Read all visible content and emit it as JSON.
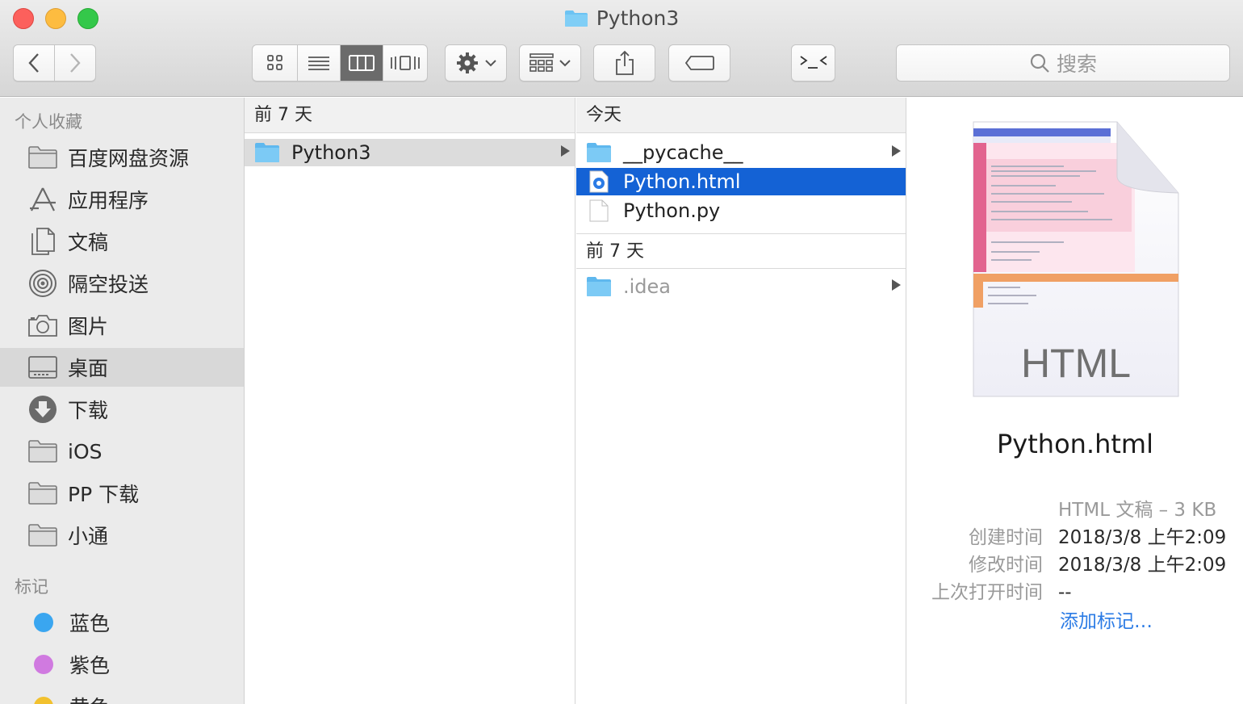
{
  "window": {
    "title": "Python3"
  },
  "toolbar": {
    "search_placeholder": "搜索"
  },
  "sidebar": {
    "favorites_heading": "个人收藏",
    "favorites": [
      {
        "label": "百度网盘资源",
        "icon": "folder-icon"
      },
      {
        "label": "应用程序",
        "icon": "applications-icon"
      },
      {
        "label": "文稿",
        "icon": "documents-icon"
      },
      {
        "label": "隔空投送",
        "icon": "airdrop-icon"
      },
      {
        "label": "图片",
        "icon": "camera-icon"
      },
      {
        "label": "桌面",
        "icon": "desktop-icon",
        "selected": true
      },
      {
        "label": "下载",
        "icon": "download-icon"
      },
      {
        "label": "iOS",
        "icon": "folder-icon"
      },
      {
        "label": "PP 下载",
        "icon": "folder-icon"
      },
      {
        "label": "小通",
        "icon": "folder-icon"
      }
    ],
    "tags_heading": "标记",
    "tags": [
      {
        "label": "蓝色",
        "color": "#3aa6f0"
      },
      {
        "label": "紫色",
        "color": "#d07ae0"
      },
      {
        "label": "黄色",
        "color": "#f2c12e"
      }
    ]
  },
  "column1": {
    "header": "前 7 天",
    "items": [
      {
        "label": "Python3",
        "icon": "folder-icon",
        "has_children": true,
        "selected": "inactive"
      }
    ]
  },
  "column2": {
    "header_today": "今天",
    "today_items": [
      {
        "label": "__pycache__",
        "icon": "folder-icon",
        "has_children": true
      },
      {
        "label": "Python.html",
        "icon": "html-file-icon",
        "selected": "active"
      },
      {
        "label": "Python.py",
        "icon": "file-icon"
      }
    ],
    "header_week": "前 7 天",
    "week_items": [
      {
        "label": ".idea",
        "icon": "folder-icon",
        "has_children": true,
        "dimmed": true
      }
    ]
  },
  "preview": {
    "thumbnail_label": "HTML",
    "file_name": "Python.html",
    "kind_size": "HTML 文稿 – 3 KB",
    "created_label": "创建时间",
    "created_value": "2018/3/8 上午2:09",
    "modified_label": "修改时间",
    "modified_value": "2018/3/8 上午2:09",
    "opened_label": "上次打开时间",
    "opened_value": "--",
    "add_tags_link": "添加标记…"
  },
  "colors": {
    "selection_blue": "#1462d5",
    "folder_blue": "#6cc3f3",
    "link_blue": "#2b7be5"
  }
}
